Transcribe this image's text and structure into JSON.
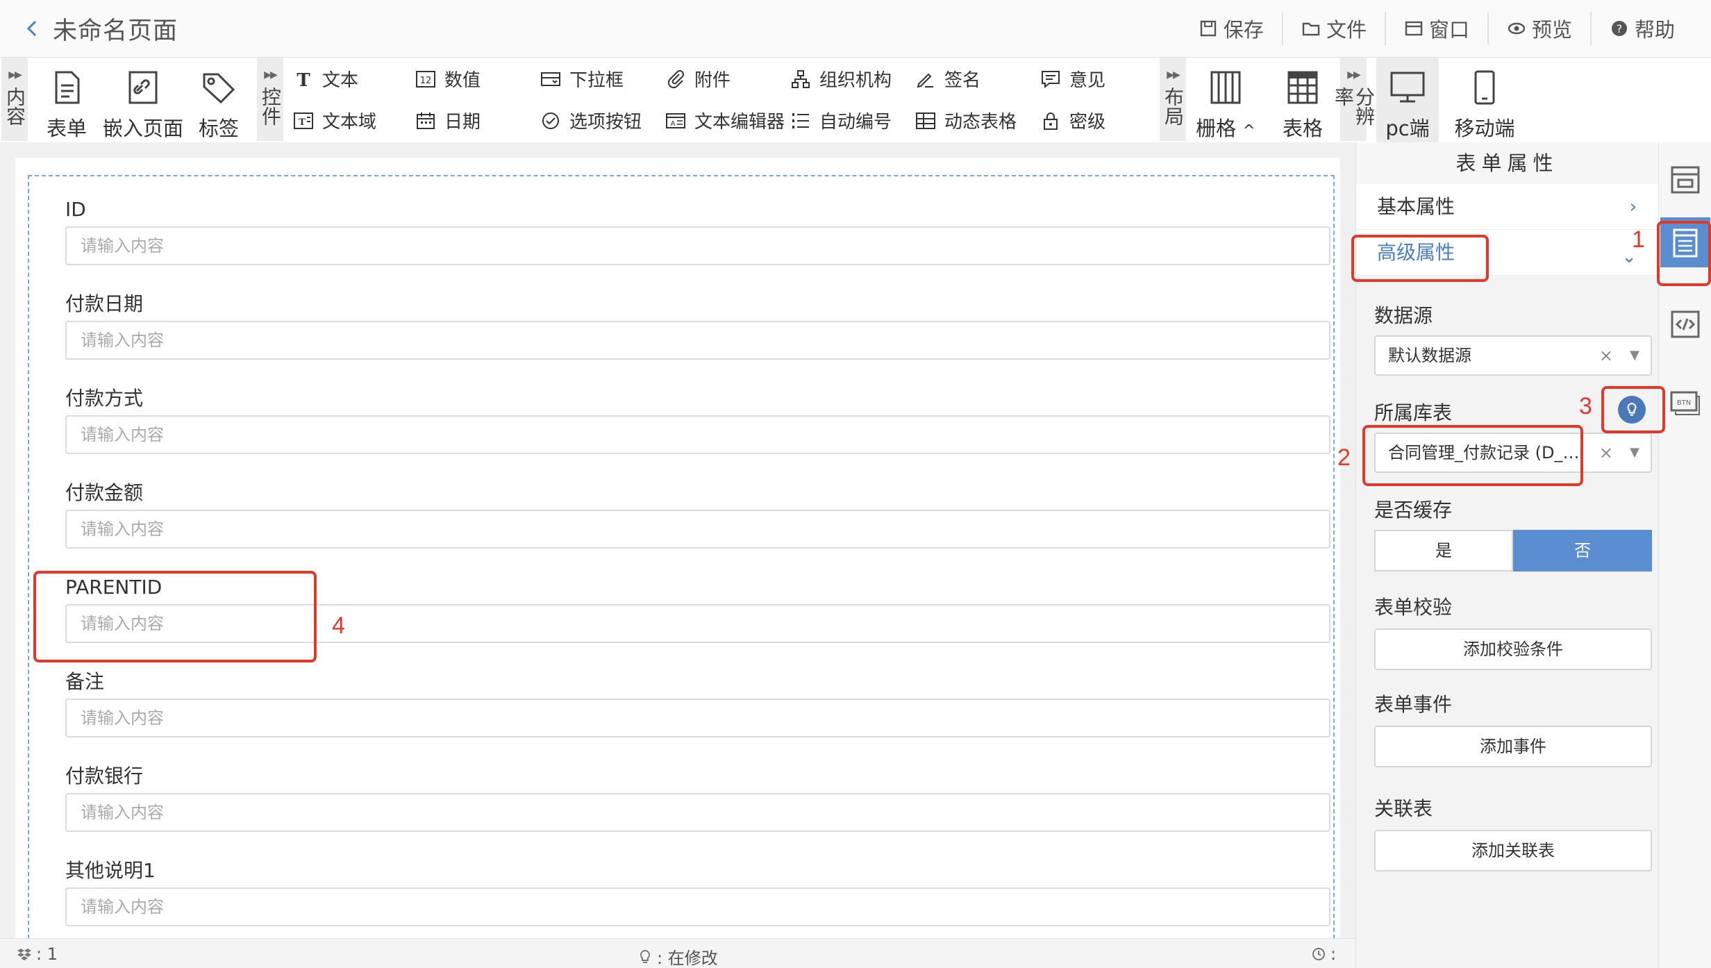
{
  "header": {
    "back_label": "<",
    "title": "未命名页面",
    "actions": {
      "save": "保存",
      "file": "文件",
      "window": "窗口",
      "preview": "预览",
      "help": "帮助"
    }
  },
  "toolbar": {
    "tab_content": "内容",
    "tab_controls": "控件",
    "tab_layout": "布局",
    "tab_resolution": "分辨率",
    "content_items": {
      "form": "表单",
      "embed": "嵌入页面",
      "tag": "标签"
    },
    "controls": {
      "text": "文本",
      "number": "数值",
      "dropdown": "下拉框",
      "attachment": "附件",
      "org": "组织机构",
      "signature": "签名",
      "opinion": "意见",
      "textarea": "文本域",
      "date": "日期",
      "option_button": "选项按钮",
      "text_editor": "文本编辑器",
      "auto_number": "自动编号",
      "dynamic_table": "动态表格",
      "security_level": "密级"
    },
    "layout_items": {
      "grid": "栅格",
      "grid_caret": "^",
      "table": "表格"
    },
    "resolution_items": {
      "pc": "pc端",
      "mobile": "移动端"
    }
  },
  "form": {
    "fields": [
      {
        "label": "ID",
        "placeholder": "请输入内容"
      },
      {
        "label": "付款日期",
        "placeholder": "请输入内容"
      },
      {
        "label": "付款方式",
        "placeholder": "请输入内容"
      },
      {
        "label": "付款金额",
        "placeholder": "请输入内容"
      },
      {
        "label": "PARENTID",
        "placeholder": "请输入内容"
      },
      {
        "label": "备注",
        "placeholder": "请输入内容"
      },
      {
        "label": "付款银行",
        "placeholder": "请输入内容"
      },
      {
        "label": "其他说明1",
        "placeholder": "请输入内容"
      }
    ]
  },
  "status": {
    "left": ": 1",
    "center": ": 在修改",
    "right": ":"
  },
  "panel": {
    "title": "表单属性",
    "basic": "基本属性",
    "advanced": "高级属性",
    "datasource_label": "数据源",
    "datasource_value": "默认数据源",
    "table_label": "所属库表",
    "table_value": "合同管理_付款记录 (D_C...",
    "cache_label": "是否缓存",
    "cache_yes": "是",
    "cache_no": "否",
    "validation_label": "表单校验",
    "validation_btn": "添加校验条件",
    "event_label": "表单事件",
    "event_btn": "添加事件",
    "relation_label": "关联表",
    "relation_btn": "添加关联表"
  },
  "annotations": [
    "1",
    "2",
    "3",
    "4"
  ],
  "colors": {
    "accent": "#5a8ed0",
    "annotation": "#e0392b",
    "link": "#4a7fc4"
  }
}
